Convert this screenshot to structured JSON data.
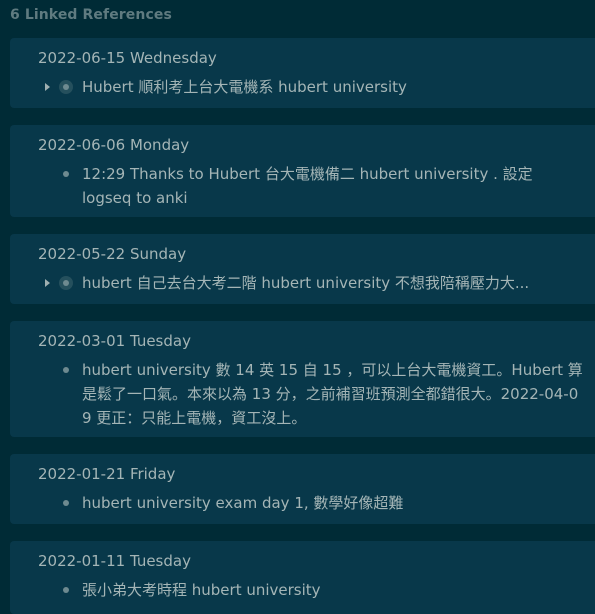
{
  "header": {
    "title": "6 Linked References"
  },
  "references": [
    {
      "date": "2022-06-15 Wednesday",
      "collapsed": true,
      "text": "Hubert 順利考上台大電機系 hubert university"
    },
    {
      "date": "2022-06-06 Monday",
      "collapsed": false,
      "text": "12:29 Thanks to Hubert 台大電機備二 hubert university . 設定 logseq to anki"
    },
    {
      "date": "2022-05-22 Sunday",
      "collapsed": true,
      "text": "hubert 自己去台大考二階 hubert university 不想我陪稱壓力大..."
    },
    {
      "date": "2022-03-01 Tuesday",
      "collapsed": false,
      "text": "hubert university 數 14 英 15 自 15 ，可以上台大電機資工。Hubert 算是鬆了一口氣。本來以為 13 分，之前補習班預測全都錯很大。2022-04-09 更正：只能上電機，資工沒上。"
    },
    {
      "date": "2022-01-21 Friday",
      "collapsed": false,
      "text": "hubert university exam day 1, 數學好像超難"
    },
    {
      "date": "2022-01-11 Tuesday",
      "collapsed": false,
      "text": "張小弟大考時程 hubert university"
    }
  ]
}
